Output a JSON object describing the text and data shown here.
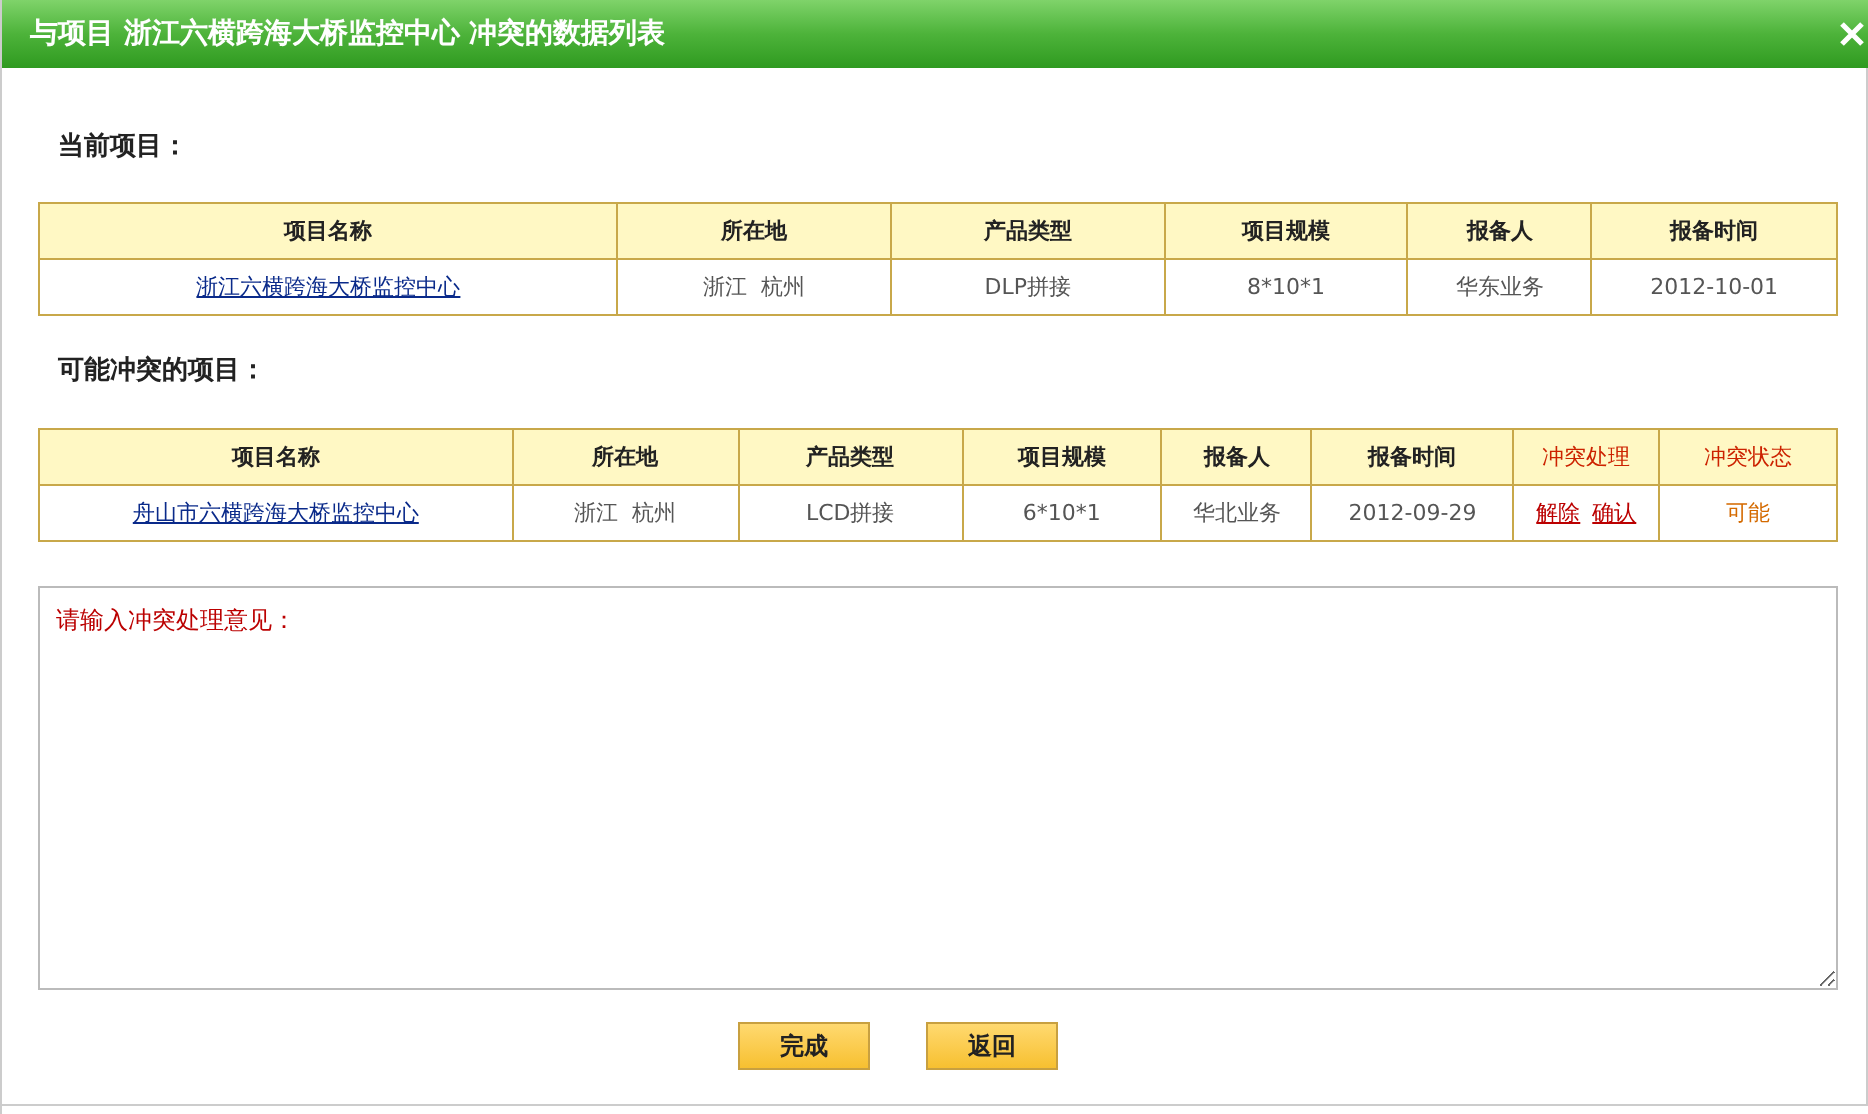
{
  "window": {
    "title": "与项目 浙江六横跨海大桥监控中心 冲突的数据列表"
  },
  "current": {
    "heading": "当前项目：",
    "columns": [
      {
        "label": "项目名称",
        "kind": "normal"
      },
      {
        "label": "所在地",
        "kind": "normal"
      },
      {
        "label": "产品类型",
        "kind": "normal"
      },
      {
        "label": "项目规模",
        "kind": "normal"
      },
      {
        "label": "报备人",
        "kind": "normal"
      },
      {
        "label": "报备时间",
        "kind": "normal"
      }
    ],
    "rows": [
      [
        {
          "kind": "link",
          "text": "浙江六横跨海大桥监控中心"
        },
        {
          "kind": "text",
          "text": "浙江  杭州"
        },
        {
          "kind": "text",
          "text": "DLP拼接"
        },
        {
          "kind": "text",
          "text": "8*10*1"
        },
        {
          "kind": "text",
          "text": "华东业务"
        },
        {
          "kind": "text",
          "text": "2012-10-01"
        }
      ]
    ]
  },
  "conflicts": {
    "heading": "可能冲突的项目：",
    "columns": [
      {
        "label": "项目名称",
        "kind": "normal"
      },
      {
        "label": "所在地",
        "kind": "normal"
      },
      {
        "label": "产品类型",
        "kind": "normal"
      },
      {
        "label": "项目规模",
        "kind": "normal"
      },
      {
        "label": "报备人",
        "kind": "normal"
      },
      {
        "label": "报备时间",
        "kind": "normal"
      },
      {
        "label": "冲突处理",
        "kind": "alert"
      },
      {
        "label": "冲突状态",
        "kind": "alert"
      }
    ],
    "rows": [
      [
        {
          "kind": "link",
          "text": "舟山市六横跨海大桥监控中心"
        },
        {
          "kind": "text",
          "text": "浙江  杭州"
        },
        {
          "kind": "text",
          "text": "LCD拼接"
        },
        {
          "kind": "text",
          "text": "6*10*1"
        },
        {
          "kind": "text",
          "text": "华北业务"
        },
        {
          "kind": "text",
          "text": "2012-09-29"
        },
        {
          "kind": "actions",
          "links": [
            "解除",
            "确认"
          ]
        },
        {
          "kind": "status",
          "text": "可能"
        }
      ]
    ]
  },
  "comment": {
    "placeholder": "请输入冲突处理意见："
  },
  "buttons": [
    "完成",
    "返回"
  ]
}
